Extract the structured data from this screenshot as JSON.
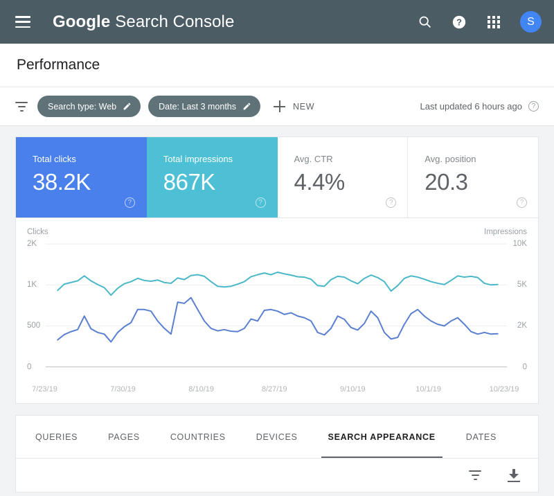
{
  "appbar": {
    "menu_icon": "hamburger-menu-icon",
    "brand_bold": "Google",
    "brand_light": "Search Console",
    "search_icon": "search-icon",
    "help_icon": "help-icon",
    "apps_icon": "apps-grid-icon",
    "avatar_initial": "S"
  },
  "page": {
    "title": "Performance"
  },
  "filters": {
    "filter_icon": "filter-icon",
    "chips": [
      {
        "label": "Search type: Web",
        "edit_icon": "pencil-icon"
      },
      {
        "label": "Date: Last 3 months",
        "edit_icon": "pencil-icon"
      }
    ],
    "new_label": "NEW",
    "new_icon": "plus-icon",
    "updated_text": "Last updated 6 hours ago",
    "updated_help_icon": "help-outline-icon"
  },
  "metrics": [
    {
      "label": "Total clicks",
      "value": "38.2K",
      "color": "#4a80ec",
      "selected": true
    },
    {
      "label": "Total impressions",
      "value": "867K",
      "color": "#4ec0d5",
      "selected": true
    },
    {
      "label": "Avg. CTR",
      "value": "4.4%",
      "color": "#ffffff",
      "selected": false
    },
    {
      "label": "Avg. position",
      "value": "20.3",
      "color": "#ffffff",
      "selected": false
    }
  ],
  "chart_data": {
    "type": "line",
    "title": "",
    "xlabel": "",
    "ylabel": "Clicks",
    "y2label": "Impressions",
    "grid": true,
    "legend": "none",
    "left_axis_label": "Clicks",
    "right_axis_label": "Impressions",
    "left_ticks": [
      "2K",
      "1K",
      "500",
      "0"
    ],
    "right_ticks": [
      "10K",
      "5K",
      "2K",
      "0"
    ],
    "left_tick_values": [
      2000,
      1000,
      500,
      0
    ],
    "right_tick_values": [
      10000,
      5000,
      2000,
      0
    ],
    "ylim": [
      0,
      2000
    ],
    "y2lim": [
      0,
      10000
    ],
    "x_tick_labels": [
      "7/23/19",
      "7/30/19",
      "8/10/19",
      "8/27/19",
      "9/10/19",
      "10/1/19",
      "10/23/19"
    ],
    "x_tick_positions": [
      0.055,
      0.205,
      0.355,
      0.495,
      0.645,
      0.79,
      0.935
    ],
    "series": [
      {
        "name": "Clicks",
        "color": "#5a7fd0",
        "axis": "left",
        "values": [
          330,
          395,
          430,
          455,
          620,
          465,
          420,
          400,
          305,
          420,
          490,
          540,
          700,
          700,
          680,
          560,
          470,
          400,
          790,
          775,
          845,
          700,
          560,
          470,
          440,
          455,
          435,
          430,
          470,
          585,
          560,
          690,
          700,
          680,
          640,
          660,
          620,
          600,
          560,
          420,
          390,
          470,
          620,
          580,
          480,
          450,
          530,
          680,
          600,
          420,
          340,
          360,
          520,
          650,
          700,
          620,
          560,
          520,
          500,
          560,
          600,
          520,
          430,
          400,
          420,
          400,
          405
        ]
      },
      {
        "name": "Impressions",
        "color": "#4ab8c6",
        "axis": "right",
        "values": [
          4600,
          5100,
          5300,
          5500,
          6100,
          5500,
          5050,
          4800,
          4250,
          4750,
          5150,
          5400,
          5800,
          5550,
          5450,
          5600,
          5300,
          5200,
          5850,
          5650,
          6150,
          6250,
          6050,
          5400,
          4900,
          4850,
          4900,
          5100,
          5400,
          6000,
          6250,
          6450,
          6250,
          6550,
          6350,
          6200,
          6000,
          5950,
          5700,
          4950,
          4900,
          5650,
          6050,
          5950,
          5500,
          5150,
          5800,
          6200,
          5900,
          5400,
          4550,
          4950,
          5800,
          6100,
          5950,
          5700,
          5400,
          5200,
          5050,
          5550,
          6100,
          5950,
          6050,
          5900,
          5200,
          5000,
          5050
        ]
      }
    ]
  },
  "tabs": [
    {
      "label": "QUERIES",
      "active": false
    },
    {
      "label": "PAGES",
      "active": false
    },
    {
      "label": "COUNTRIES",
      "active": false
    },
    {
      "label": "DEVICES",
      "active": false
    },
    {
      "label": "SEARCH APPEARANCE",
      "active": true
    },
    {
      "label": "DATES",
      "active": false
    }
  ],
  "table_tools": {
    "filter_icon": "filter-icon",
    "download_icon": "download-icon"
  }
}
